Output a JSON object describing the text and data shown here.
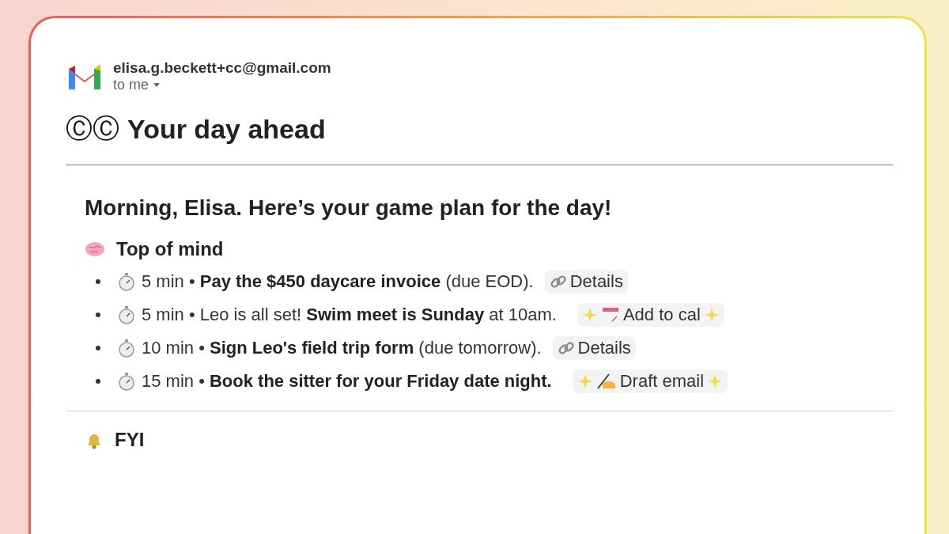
{
  "sender": {
    "email": "elisa.g.beckett+cc@gmail.com",
    "recipient": "to me"
  },
  "title": {
    "mark": "ⒸⒸ",
    "text": "Your day ahead"
  },
  "greeting": "Morning, Elisa. Here’s your game plan for the day!",
  "sections": [
    {
      "kind": "brain",
      "heading": "Top of mind",
      "items": [
        {
          "time": "5 min •",
          "text": "**Pay the $450 daycare invoice** (due EOD).",
          "action": {
            "kind": "details",
            "label": "Details"
          }
        },
        {
          "time": "5 min •",
          "text": "Leo is all set! **Swim meet is Sunday** at 10am.",
          "action": {
            "kind": "calendar",
            "label": "Add to cal"
          }
        },
        {
          "time": "10 min •",
          "text": "**Sign Leo's field trip form** (due tomorrow).",
          "action": {
            "kind": "details",
            "label": "Details"
          }
        },
        {
          "time": "15 min •",
          "text": "**Book the sitter for your Friday date night.**",
          "action": {
            "kind": "draft",
            "label": "Draft email"
          }
        }
      ]
    },
    {
      "kind": "bell",
      "heading": "FYI"
    }
  ]
}
